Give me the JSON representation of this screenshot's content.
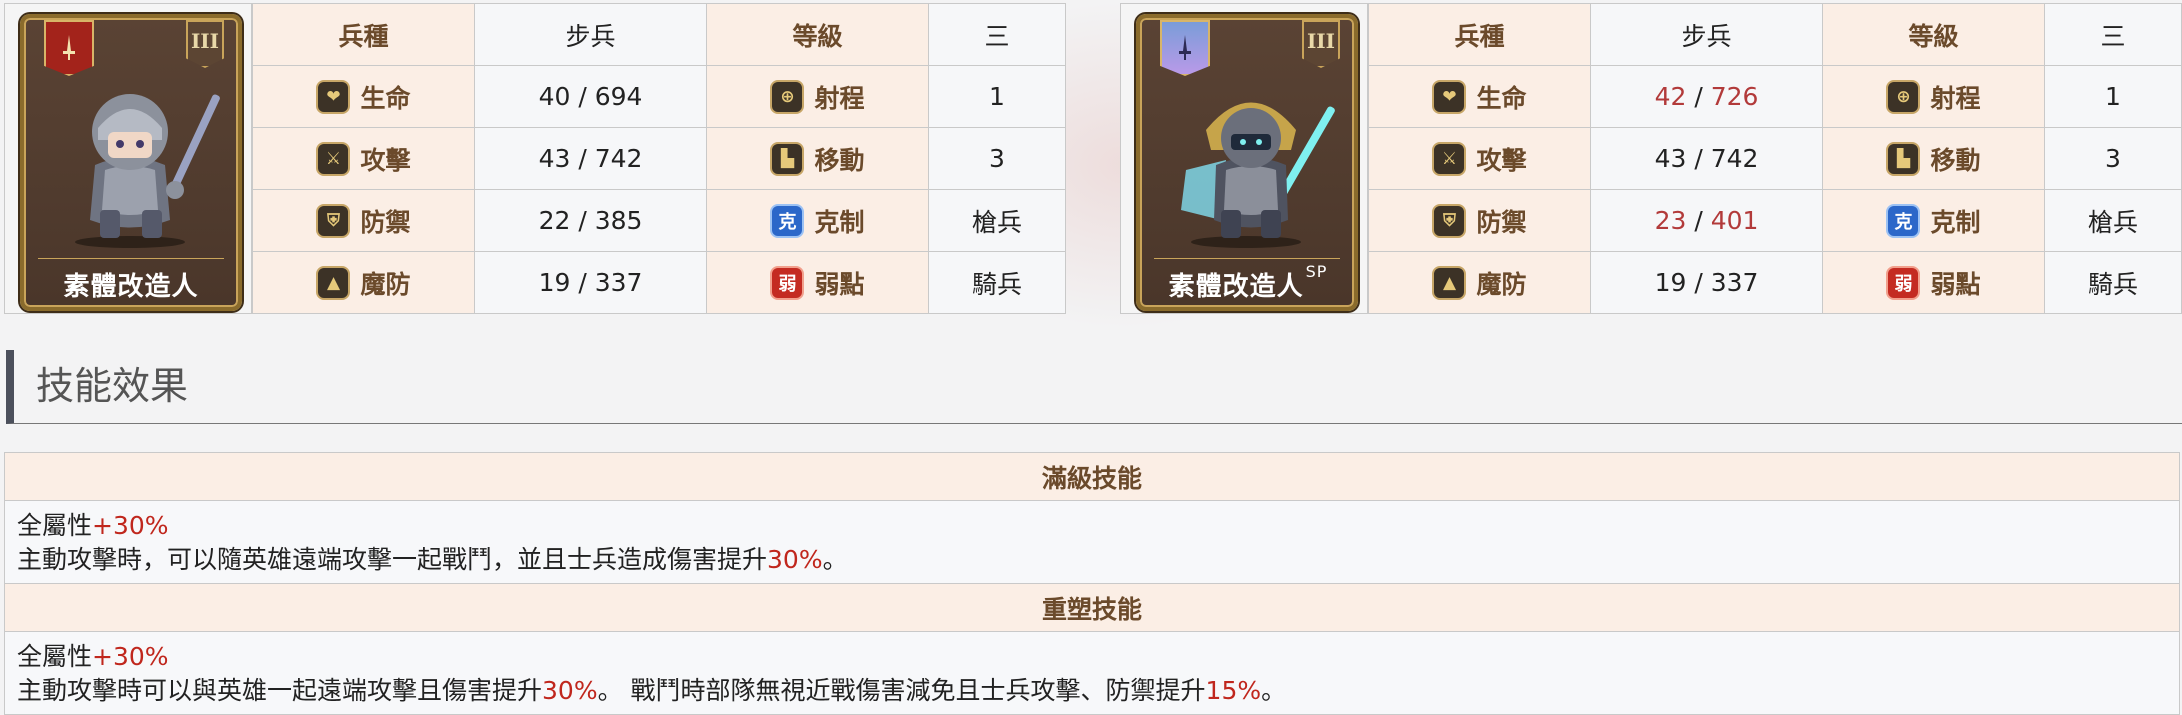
{
  "units": [
    {
      "name": "素體改造人",
      "name_sup": "",
      "tier_badge": "III",
      "headers": {
        "class_label": "兵種",
        "class_value": "步兵",
        "level_label": "等級",
        "level_value": "三"
      },
      "rows": [
        {
          "stat_label": "生命",
          "stat_icon": "heart-icon",
          "stat_value_a": "40",
          "stat_value_b": "694",
          "stat_highlight": false,
          "attr_label": "射程",
          "attr_icon": "crosshair-icon",
          "attr_value": "1"
        },
        {
          "stat_label": "攻擊",
          "stat_icon": "sword-icon",
          "stat_value_a": "43",
          "stat_value_b": "742",
          "stat_highlight": false,
          "attr_label": "移動",
          "attr_icon": "boot-icon",
          "attr_value": "3"
        },
        {
          "stat_label": "防禦",
          "stat_icon": "shield-icon",
          "stat_value_a": "22",
          "stat_value_b": "385",
          "stat_highlight": false,
          "attr_label": "克制",
          "attr_icon": "counter-icon",
          "attr_icon_text": "克",
          "attr_value": "槍兵"
        },
        {
          "stat_label": "魔防",
          "stat_icon": "magic-defense-icon",
          "stat_value_a": "19",
          "stat_value_b": "337",
          "stat_highlight": false,
          "attr_label": "弱點",
          "attr_icon": "weakness-icon",
          "attr_icon_text": "弱",
          "attr_value": "騎兵"
        }
      ]
    },
    {
      "name": "素體改造人",
      "name_sup": "SP",
      "tier_badge": "III",
      "headers": {
        "class_label": "兵種",
        "class_value": "步兵",
        "level_label": "等級",
        "level_value": "三"
      },
      "rows": [
        {
          "stat_label": "生命",
          "stat_icon": "heart-icon",
          "stat_value_a": "42",
          "stat_value_b": "726",
          "stat_highlight": true,
          "attr_label": "射程",
          "attr_icon": "crosshair-icon",
          "attr_value": "1"
        },
        {
          "stat_label": "攻擊",
          "stat_icon": "sword-icon",
          "stat_value_a": "43",
          "stat_value_b": "742",
          "stat_highlight": false,
          "attr_label": "移動",
          "attr_icon": "boot-icon",
          "attr_value": "3"
        },
        {
          "stat_label": "防禦",
          "stat_icon": "shield-icon",
          "stat_value_a": "23",
          "stat_value_b": "401",
          "stat_highlight": true,
          "attr_label": "克制",
          "attr_icon": "counter-icon",
          "attr_icon_text": "克",
          "attr_value": "槍兵"
        },
        {
          "stat_label": "魔防",
          "stat_icon": "magic-defense-icon",
          "stat_value_a": "19",
          "stat_value_b": "337",
          "stat_highlight": false,
          "attr_label": "弱點",
          "attr_icon": "weakness-icon",
          "attr_icon_text": "弱",
          "attr_value": "騎兵"
        }
      ]
    }
  ],
  "section": {
    "title": "技能效果"
  },
  "skills": [
    {
      "header": "滿級技能",
      "line1": {
        "a": "全屬性",
        "b": "+30%"
      },
      "line2": {
        "a": "主動攻擊時，可以隨英雄遠端攻擊一起戰鬥，並且士兵造成傷害提升",
        "b": "30%",
        "c": "。",
        "d": "",
        "e": ""
      }
    },
    {
      "header": "重塑技能",
      "line1": {
        "a": "全屬性",
        "b": "+30%"
      },
      "line2": {
        "a": "主動攻擊時可以與英雄一起遠端攻擊且傷害提升",
        "b": "30%",
        "c": "。 戰鬥時部隊無視近戰傷害減免且士兵攻擊、防禦提升",
        "d": "15%",
        "e": "。"
      }
    }
  ],
  "colors": {
    "label_bg": "#fbeee5",
    "label_text": "#6b4a2b",
    "highlight_red": "#c0271d",
    "stat_highlight": "#b23a3a"
  }
}
